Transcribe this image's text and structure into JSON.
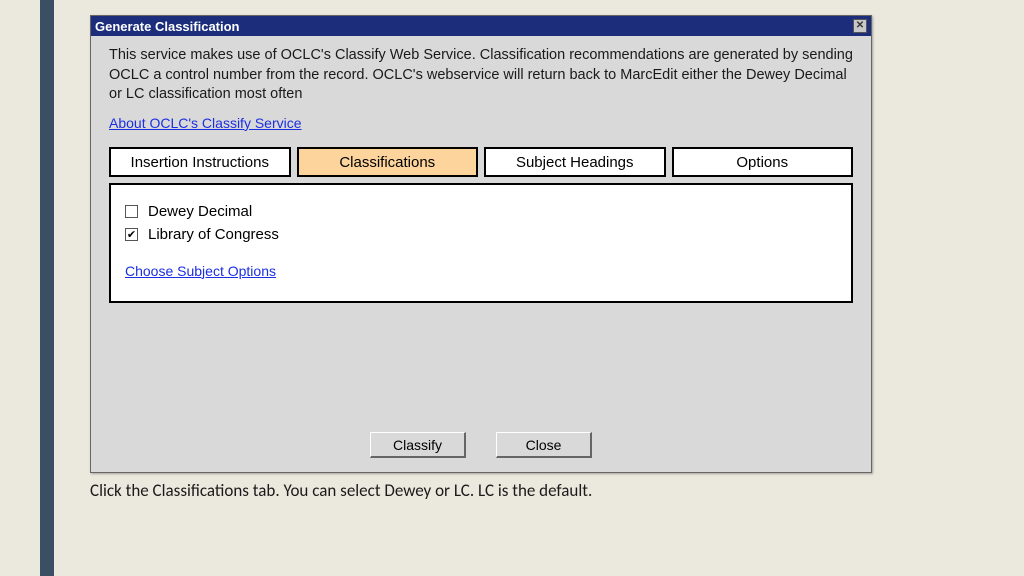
{
  "dialog": {
    "title": "Generate Classification",
    "description": "This service makes use of OCLC's Classify Web Service.  Classification recommendations are generated by sending OCLC a control number from the record.  OCLC's webservice will return back to MarcEdit either the Dewey Decimal or LC classification most often",
    "about_link": "About OCLC's Classify Service",
    "tabs": {
      "insertion": "Insertion Instructions",
      "classifications": "Classifications",
      "subjects": "Subject Headings",
      "options": "Options"
    },
    "checks": {
      "dewey": "Dewey Decimal",
      "lc": "Library of Congress"
    },
    "subject_link": "Choose Subject Options",
    "buttons": {
      "classify": "Classify",
      "close": "Close"
    },
    "close_x": "✕"
  },
  "caption": "Click the Classifications tab. You can select Dewey or LC. LC is the default."
}
